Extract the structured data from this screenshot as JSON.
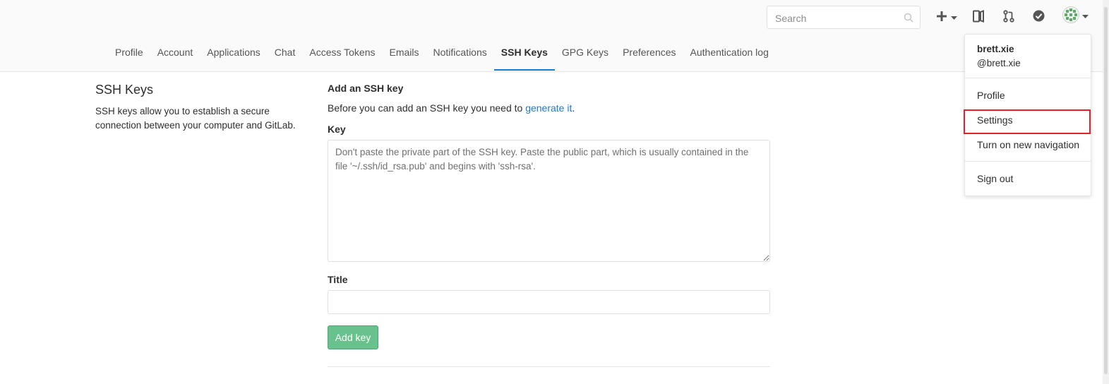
{
  "header": {
    "search_placeholder": "Search",
    "icons": [
      "plus-icon",
      "chevron-down-icon",
      "sidebar-panel-icon",
      "merge-request-icon",
      "todo-check-icon",
      "avatar",
      "chevron-down-icon"
    ]
  },
  "tabs": [
    {
      "label": "Profile"
    },
    {
      "label": "Account"
    },
    {
      "label": "Applications"
    },
    {
      "label": "Chat"
    },
    {
      "label": "Access Tokens"
    },
    {
      "label": "Emails"
    },
    {
      "label": "Notifications"
    },
    {
      "label": "SSH Keys",
      "active": true
    },
    {
      "label": "GPG Keys"
    },
    {
      "label": "Preferences"
    },
    {
      "label": "Authentication log"
    }
  ],
  "left": {
    "title": "SSH Keys",
    "description": "SSH keys allow you to establish a secure connection between your computer and GitLab."
  },
  "form": {
    "section_title": "Add an SSH key",
    "intro_text": "Before you can add an SSH key you need to ",
    "intro_link": "generate it",
    "intro_end": ".",
    "key_label": "Key",
    "key_placeholder": "Don't paste the private part of the SSH key. Paste the public part, which is usually contained in the file '~/.ssh/id_rsa.pub' and begins with 'ssh-rsa'.",
    "title_label": "Title",
    "title_value": "",
    "submit_label": "Add key"
  },
  "user_menu": {
    "name": "brett.xie",
    "handle": "@brett.xie",
    "items": [
      "Profile",
      "Settings",
      "Turn on new navigation",
      "Sign out"
    ],
    "highlighted": "Settings"
  },
  "colors": {
    "accent": "#1f78d1",
    "success": "#69c28d",
    "highlight": "#e8202a"
  }
}
